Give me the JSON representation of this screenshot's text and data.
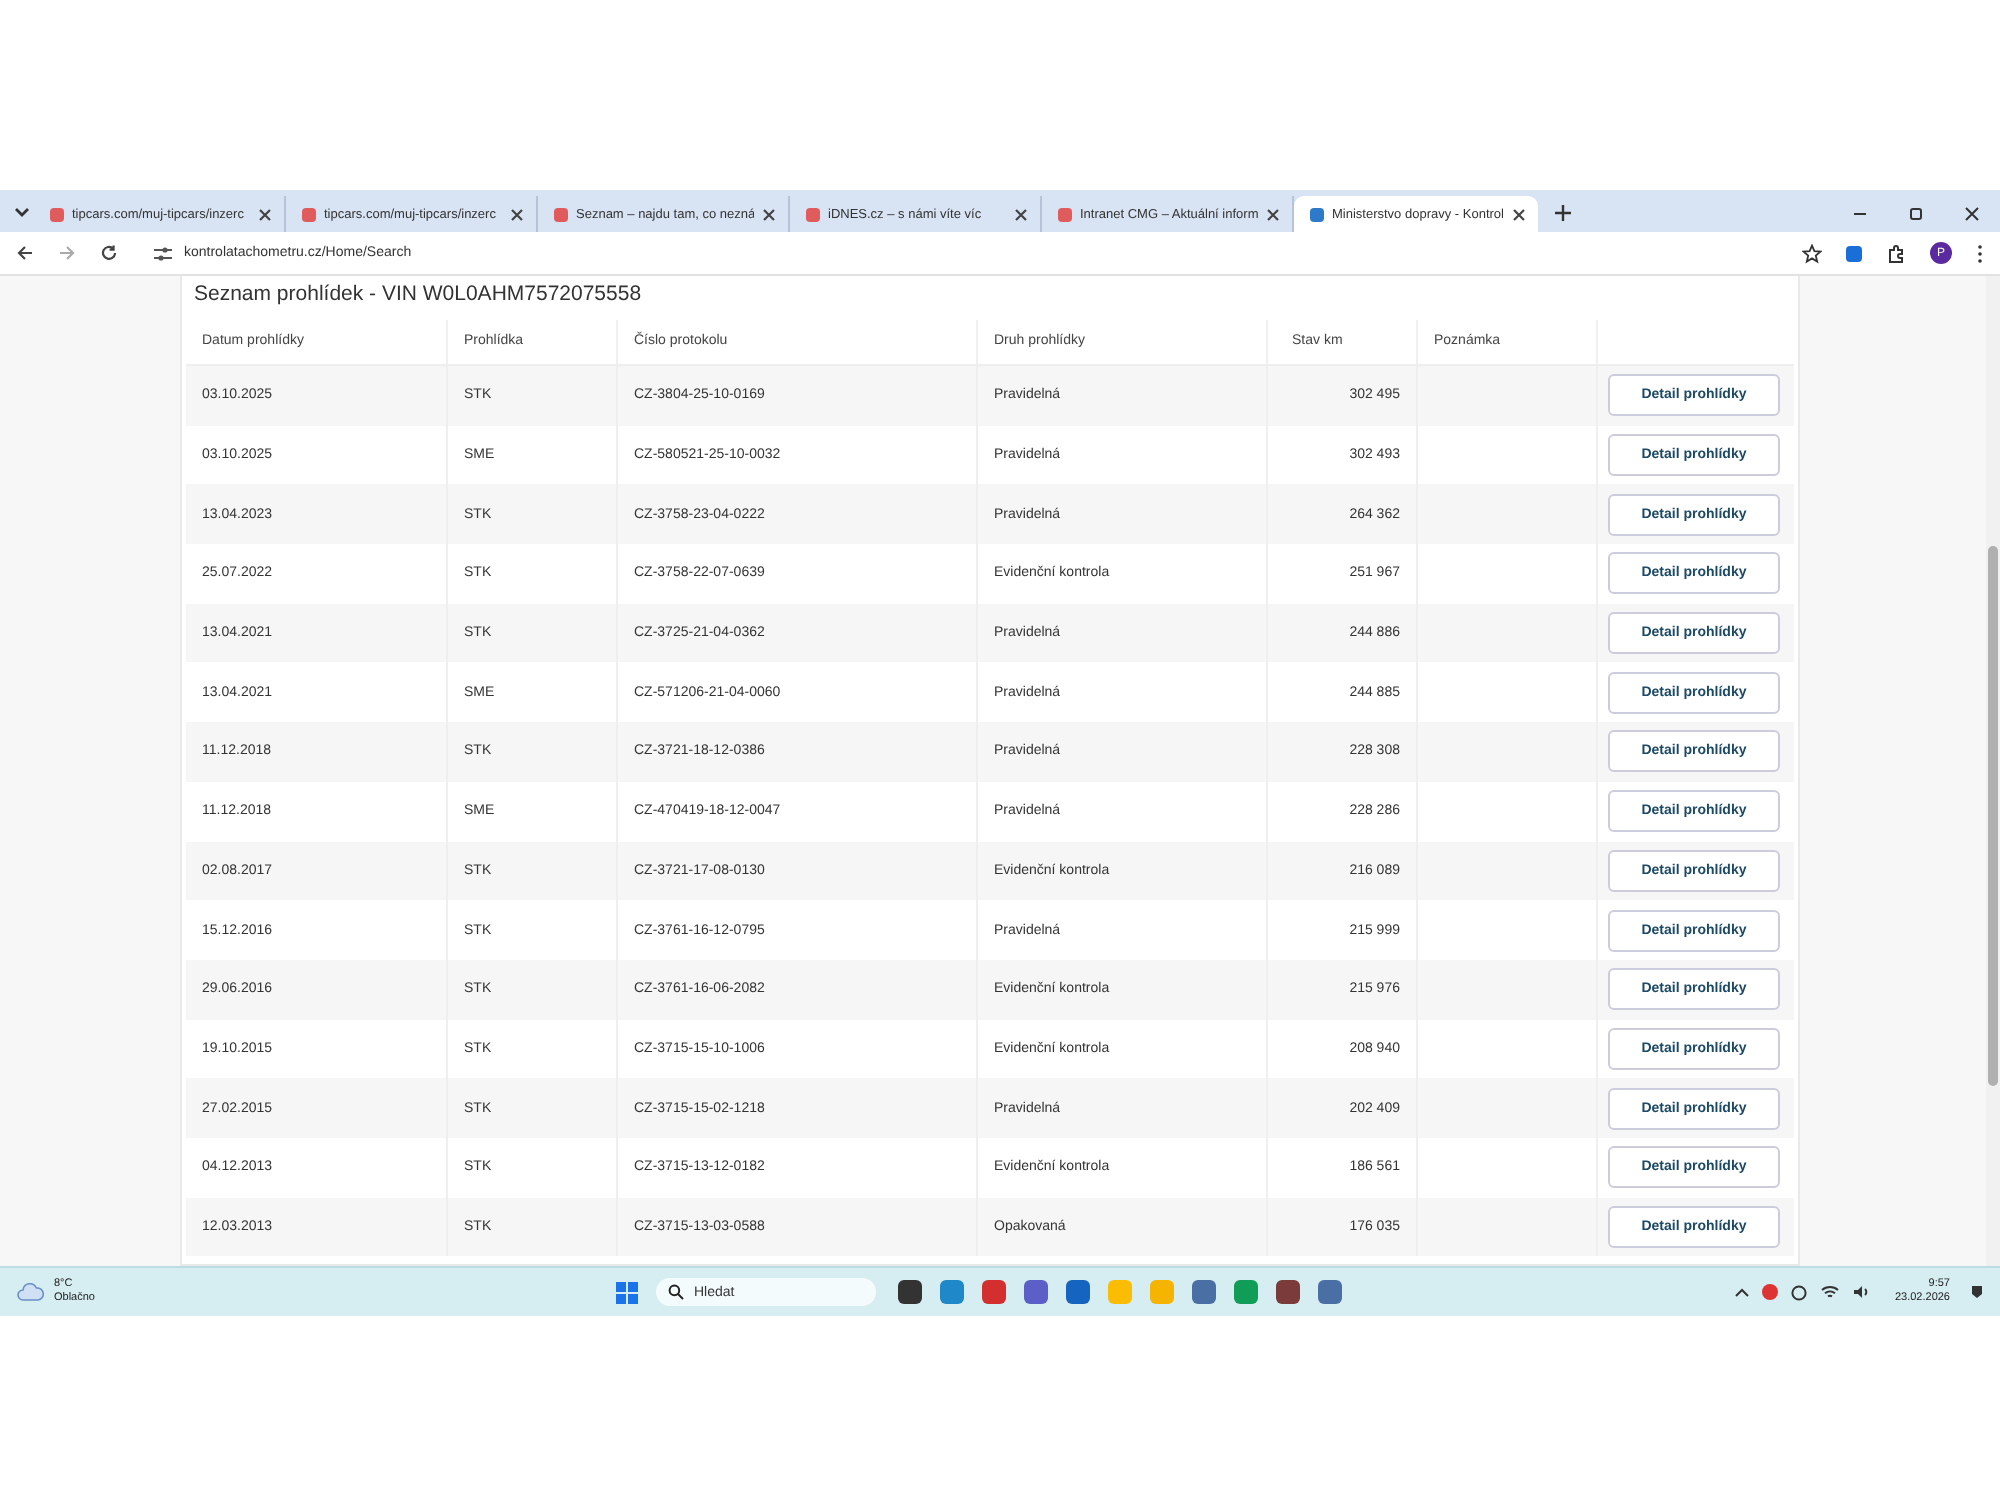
{
  "browser": {
    "tabs": [
      {
        "label": "tipcars.com/muj-tipcars/inzerc",
        "selected": false
      },
      {
        "label": "tipcars.com/muj-tipcars/inzerc",
        "selected": false
      },
      {
        "label": "Seznam – najdu tam, co nezná",
        "selected": false
      },
      {
        "label": "iDNES.cz – s námi víte víc",
        "selected": false
      },
      {
        "label": "Intranet CMG – Aktuální inform",
        "selected": false
      },
      {
        "label": "Ministerstvo dopravy - Kontrol",
        "selected": true
      }
    ],
    "address": "kontrolatachometru.cz/Home/Search",
    "profile_initial": "P"
  },
  "page": {
    "title": "Seznam prohlídek - VIN W0L0AHM7572075558",
    "columns": [
      "Datum prohlídky",
      "Prohlídka",
      "Číslo protokolu",
      "Druh prohlídky",
      "Stav km",
      "Poznámka"
    ],
    "rows": [
      {
        "date": "03.10.2025",
        "type": "STK",
        "protocol": "CZ-3804-25-10-0169",
        "kind": "Pravidelná",
        "km": "302 495",
        "button": "Detail prohlídky"
      },
      {
        "date": "03.10.2025",
        "type": "SME",
        "protocol": "CZ-580521-25-10-0032",
        "kind": "Pravidelná",
        "km": "302 493",
        "button": "Detail prohlídky"
      },
      {
        "date": "13.04.2023",
        "type": "STK",
        "protocol": "CZ-3758-23-04-0222",
        "kind": "Pravidelná",
        "km": "264 362",
        "button": "Detail prohlídky"
      },
      {
        "date": "25.07.2022",
        "type": "STK",
        "protocol": "CZ-3758-22-07-0639",
        "kind": "Evidenční kontrola",
        "km": "251 967",
        "button": "Detail prohlídky"
      },
      {
        "date": "13.04.2021",
        "type": "STK",
        "protocol": "CZ-3725-21-04-0362",
        "kind": "Pravidelná",
        "km": "244 886",
        "button": "Detail prohlídky"
      },
      {
        "date": "13.04.2021",
        "type": "SME",
        "protocol": "CZ-571206-21-04-0060",
        "kind": "Pravidelná",
        "km": "244 885",
        "button": "Detail prohlídky"
      },
      {
        "date": "11.12.2018",
        "type": "STK",
        "protocol": "CZ-3721-18-12-0386",
        "kind": "Pravidelná",
        "km": "228 308",
        "button": "Detail prohlídky"
      },
      {
        "date": "11.12.2018",
        "type": "SME",
        "protocol": "CZ-470419-18-12-0047",
        "kind": "Pravidelná",
        "km": "228 286",
        "button": "Detail prohlídky"
      },
      {
        "date": "02.08.2017",
        "type": "STK",
        "protocol": "CZ-3721-17-08-0130",
        "kind": "Evidenční kontrola",
        "km": "216 089",
        "button": "Detail prohlídky"
      },
      {
        "date": "15.12.2016",
        "type": "STK",
        "protocol": "CZ-3761-16-12-0795",
        "kind": "Pravidelná",
        "km": "215 999",
        "button": "Detail prohlídky"
      },
      {
        "date": "29.06.2016",
        "type": "STK",
        "protocol": "CZ-3761-16-06-2082",
        "kind": "Evidenční kontrola",
        "km": "215 976",
        "button": "Detail prohlídky"
      },
      {
        "date": "19.10.2015",
        "type": "STK",
        "protocol": "CZ-3715-15-10-1006",
        "kind": "Evidenční kontrola",
        "km": "208 940",
        "button": "Detail prohlídky"
      },
      {
        "date": "27.02.2015",
        "type": "STK",
        "protocol": "CZ-3715-15-02-1218",
        "kind": "Pravidelná",
        "km": "202 409",
        "button": "Detail prohlídky"
      },
      {
        "date": "04.12.2013",
        "type": "STK",
        "protocol": "CZ-3715-13-12-0182",
        "kind": "Evidenční kontrola",
        "km": "186 561",
        "button": "Detail prohlídky"
      },
      {
        "date": "12.03.2013",
        "type": "STK",
        "protocol": "CZ-3715-13-03-0588",
        "kind": "Opakovaná",
        "km": "176 035",
        "button": "Detail prohlídky"
      }
    ]
  },
  "taskbar": {
    "temperature": "8°C",
    "weather": "Oblačno",
    "search_placeholder": "Hledat",
    "time": "9:57",
    "date": "23.02.2026"
  }
}
